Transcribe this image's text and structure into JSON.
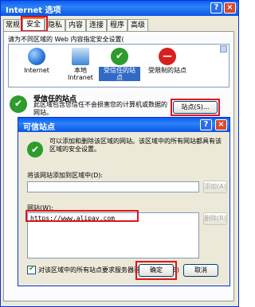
{
  "outer_dialog": {
    "title": "Internet 选项",
    "tabs": [
      "常规",
      "安全",
      "隐私",
      "内容",
      "连接",
      "程序",
      "高级"
    ],
    "active_tab": "安全",
    "instruction": "请为不同区域的 Web 内容指定安全设置(",
    "zones": [
      {
        "label": "Internet",
        "icon": "globe-icon",
        "color": "#2a74d9"
      },
      {
        "label": "本地\nIntranet",
        "icon": "intranet-icon",
        "color": "#3b86d6"
      },
      {
        "label": "受信任的站\n点",
        "icon": "check-icon",
        "color": "#2d9b2d"
      },
      {
        "label": "受限制的站点",
        "icon": "restricted-icon",
        "color": "#d62020"
      }
    ],
    "section_title": "受信任的站点",
    "section_desc": "此区域包含您信任不会损害您的计算机或数据的网站。",
    "sites_button": "站点(S)..."
  },
  "trusted_dialog": {
    "title": "可信站点",
    "description": "可以添加和删除该区域的网站。该区域中的所有网站都具有该区域的安全设置。",
    "add_label": "将该网站添加到区域中(D):",
    "add_button": "添加(A)",
    "sites_label": "网站(W):",
    "sites": [
      "https://www.alipay.com"
    ],
    "remove_button": "删除(R)",
    "require_https_label": "对该区域中的所有站点要求服务器验证(https:)(S)",
    "ok_button": "确定",
    "cancel_button": "取消"
  },
  "highlight_color": "#e0131a"
}
